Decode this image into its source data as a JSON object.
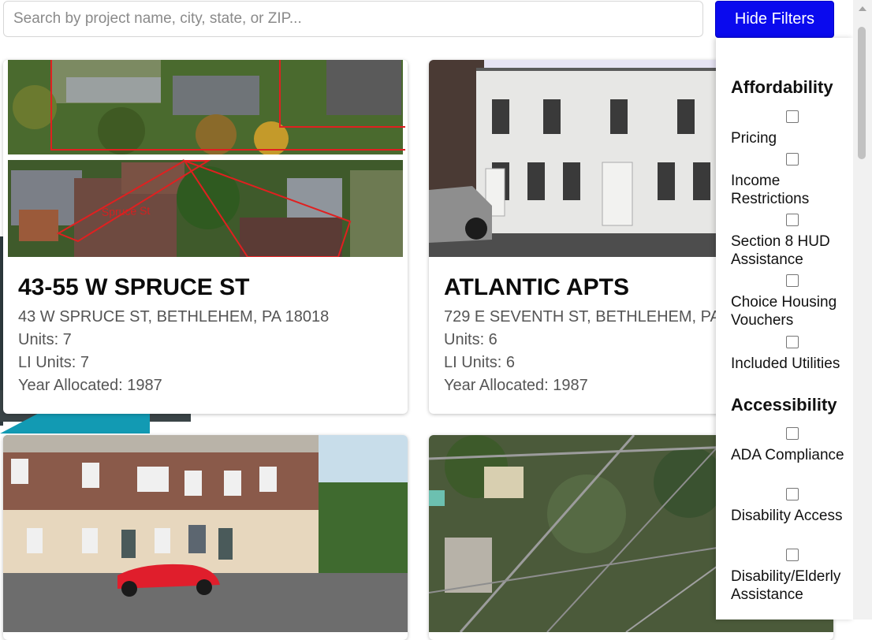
{
  "search": {
    "placeholder": "Search by project name, city, state, or ZIP..."
  },
  "toolbar": {
    "filter_toggle_label": "Hide Filters"
  },
  "cards": [
    {
      "title": "43-55 W SPRUCE ST",
      "address": "43 W SPRUCE ST, BETHLEHEM, PA 18018",
      "units": "Units: 7",
      "li_units": "LI Units: 7",
      "year": "Year Allocated: 1987",
      "photo_label": "Spruce St"
    },
    {
      "title": "ATLANTIC APTS",
      "address": "729 E SEVENTH ST, BETHLEHEM, PA",
      "units": "Units: 6",
      "li_units": "LI Units: 6",
      "year": "Year Allocated: 1987"
    },
    {
      "title": "",
      "address": "",
      "units": "",
      "li_units": "",
      "year": ""
    },
    {
      "title": "",
      "address": "",
      "units": "",
      "li_units": "",
      "year": ""
    }
  ],
  "filters": {
    "sections": [
      {
        "heading": "Affordability",
        "options": [
          "Pricing",
          "Income Restrictions",
          "Section 8 HUD Assistance",
          "Choice Housing Vouchers",
          "Included Utilities"
        ]
      },
      {
        "heading": "Accessibility",
        "options": [
          "ADA Compliance",
          "Disability Access",
          "Disability/Elderly Assistance"
        ]
      }
    ]
  },
  "colors": {
    "accent": "#0a0aee",
    "panel_bg": "#ffffff"
  }
}
